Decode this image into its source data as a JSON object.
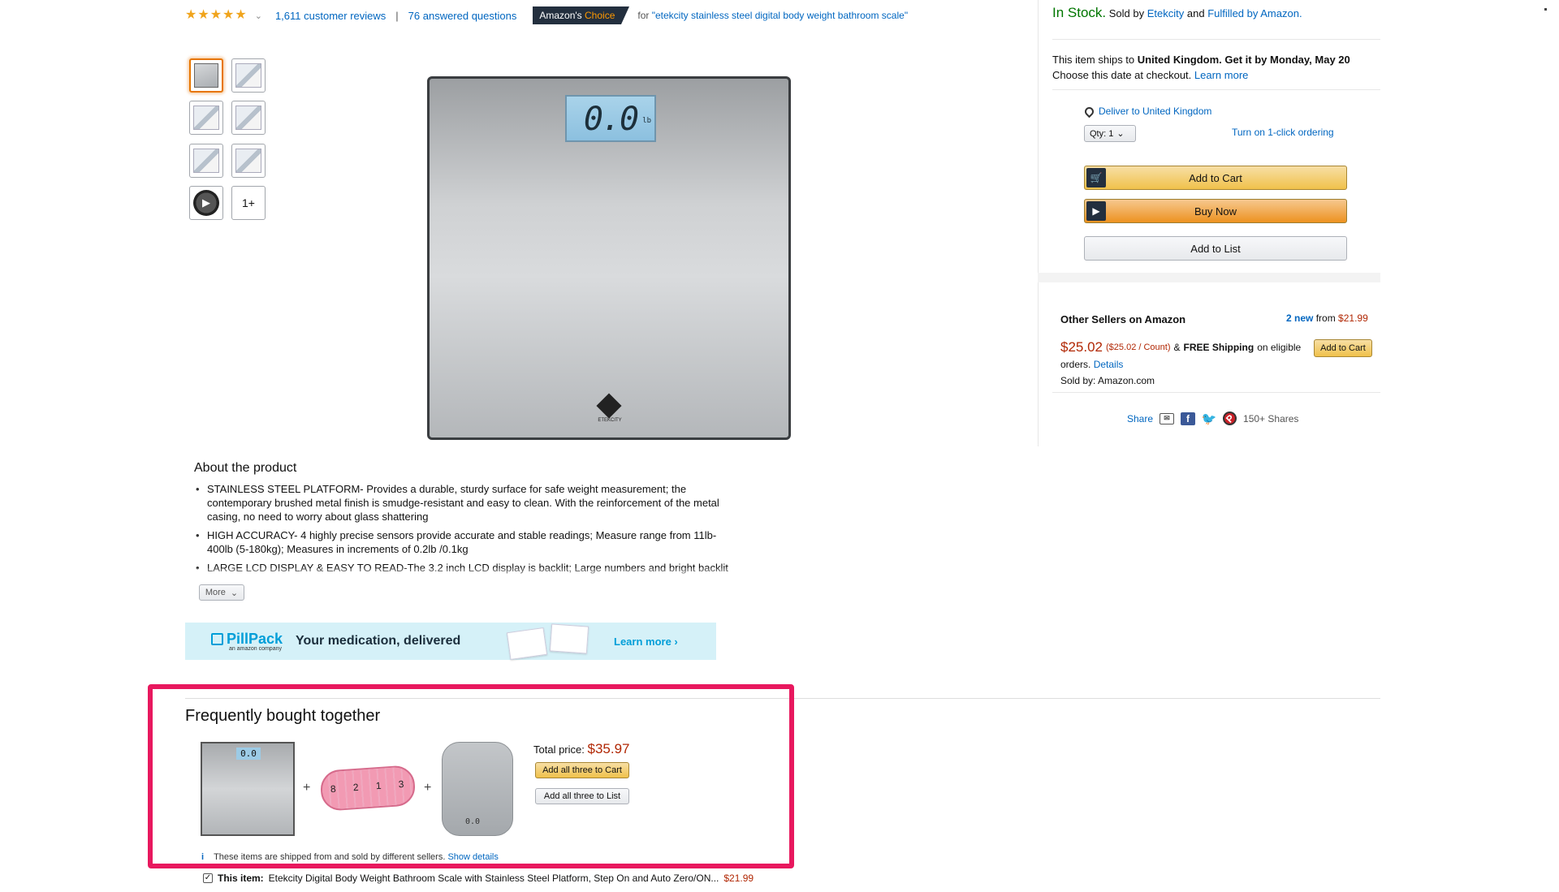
{
  "rating": {
    "stars": "4.5",
    "reviews_link": "1,611 customer reviews",
    "separator": "|",
    "questions_link": "76 answered questions",
    "badge_prefix": "Amazon's",
    "badge_suffix": "Choice",
    "badge_for": "for",
    "badge_query": "\"etekcity stainless steel digital body weight bathroom scale\""
  },
  "thumbnails": {
    "more_label": "1+"
  },
  "main_image": {
    "lcd_value": "0.0",
    "lcd_unit": "lb",
    "brand": "ETEKCITY"
  },
  "about": {
    "title": "About the product",
    "bullets": [
      "STAINLESS STEEL PLATFORM- Provides a durable, sturdy surface for safe weight measurement; the contemporary brushed metal finish is smudge-resistant and easy to clean. With the reinforcement of the metal casing, no need to worry about glass shattering",
      "HIGH ACCURACY- 4 highly precise sensors provide accurate and stable readings; Measure range from 11lb-400lb (5-180kg); Measures in increments of 0.2lb /0.1kg",
      "LARGE LCD DISPLAY & EASY TO READ-The 3.2 inch LCD display is backlit; Large numbers and bright backlit display are easy to read even in bright daylight or dark rooms"
    ],
    "more_label": "More"
  },
  "pillpack": {
    "name": "PillPack",
    "sub": "an amazon company",
    "tagline": "Your medication, delivered",
    "learn_more": "Learn more ›"
  },
  "buybox": {
    "in_stock": "In Stock.",
    "sold_by_prefix": "Sold by",
    "seller": "Etekcity",
    "and": "and",
    "fulfilled": "Fulfilled by Amazon.",
    "ships_prefix": "This item ships to",
    "ships_country": "United Kingdom",
    "get_it": ". Get it by Monday, May 20",
    "choose_date": "Choose this date at checkout.",
    "learn_more": "Learn more",
    "deliver_to": "Deliver to United Kingdom",
    "qty_label": "Qty: 1",
    "one_click": "Turn on 1-click ordering",
    "add_to_cart": "Add to Cart",
    "buy_now": "Buy Now",
    "add_to_list": "Add to List"
  },
  "other_sellers": {
    "title": "Other Sellers on Amazon",
    "new_count": "2 new",
    "from": "from",
    "from_price": "$21.99",
    "price": "$25.02",
    "unit_price": "($25.02 / Count)",
    "shipping_amp": "&",
    "shipping": "FREE Shipping",
    "eligible": "on eligible",
    "orders": "orders.",
    "details": "Details",
    "add_to_cart": "Add to Cart",
    "sold_by": "Sold by: Amazon.com"
  },
  "share": {
    "label": "Share",
    "count": "150+ Shares"
  },
  "fbt": {
    "title": "Frequently bought together",
    "lcd": "0.0",
    "plus": "+",
    "total_label": "Total price:",
    "total_price": "$35.97",
    "add_all_cart": "Add all three to Cart",
    "add_all_list": "Add all three to List",
    "note": "These items are shipped from and sold by different sellers.",
    "show_details": "Show details",
    "this_item_label": "This item:",
    "this_item_title": "Etekcity Digital Body Weight Bathroom Scale with Stainless Steel Platform, Step On and Auto Zero/ON...",
    "this_item_price": "$21.99"
  },
  "colors": {
    "link": "#0066c0",
    "price": "#b12704",
    "in_stock": "#007600",
    "highlight": "#e8185e",
    "badge": "#232f3e"
  }
}
